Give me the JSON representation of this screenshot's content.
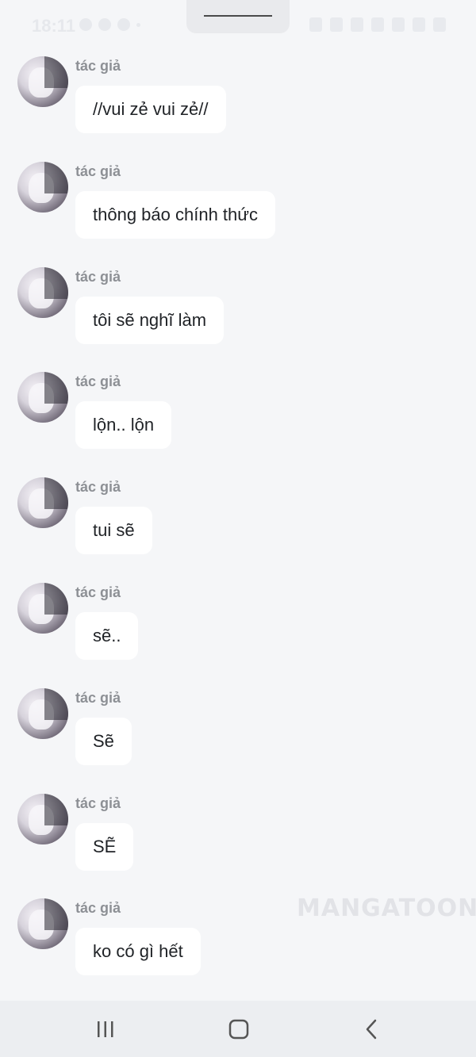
{
  "status_bar": {
    "time": "18:11"
  },
  "messages": [
    {
      "author": "tác giả",
      "text": "//vui zẻ vui zẻ//"
    },
    {
      "author": "tác giả",
      "text": "thông báo chính thức"
    },
    {
      "author": "tác giả",
      "text": "tôi sẽ nghĩ làm"
    },
    {
      "author": "tác giả",
      "text": "lộn.. lộn"
    },
    {
      "author": "tác giả",
      "text": "tui sẽ"
    },
    {
      "author": "tác giả",
      "text": "sẽ.."
    },
    {
      "author": "tác giả",
      "text": "Sẽ"
    },
    {
      "author": "tác giả",
      "text": "SẼ"
    },
    {
      "author": "tác giả",
      "text": "ko có gì hết"
    }
  ],
  "watermark": "MANGATOON",
  "colors": {
    "background": "#f5f6f8",
    "bubble": "#ffffff",
    "author_text": "#8d9095",
    "message_text": "#1f2226"
  },
  "nav_bar": {
    "icons": [
      "recent-apps-icon",
      "home-icon",
      "back-icon"
    ]
  }
}
